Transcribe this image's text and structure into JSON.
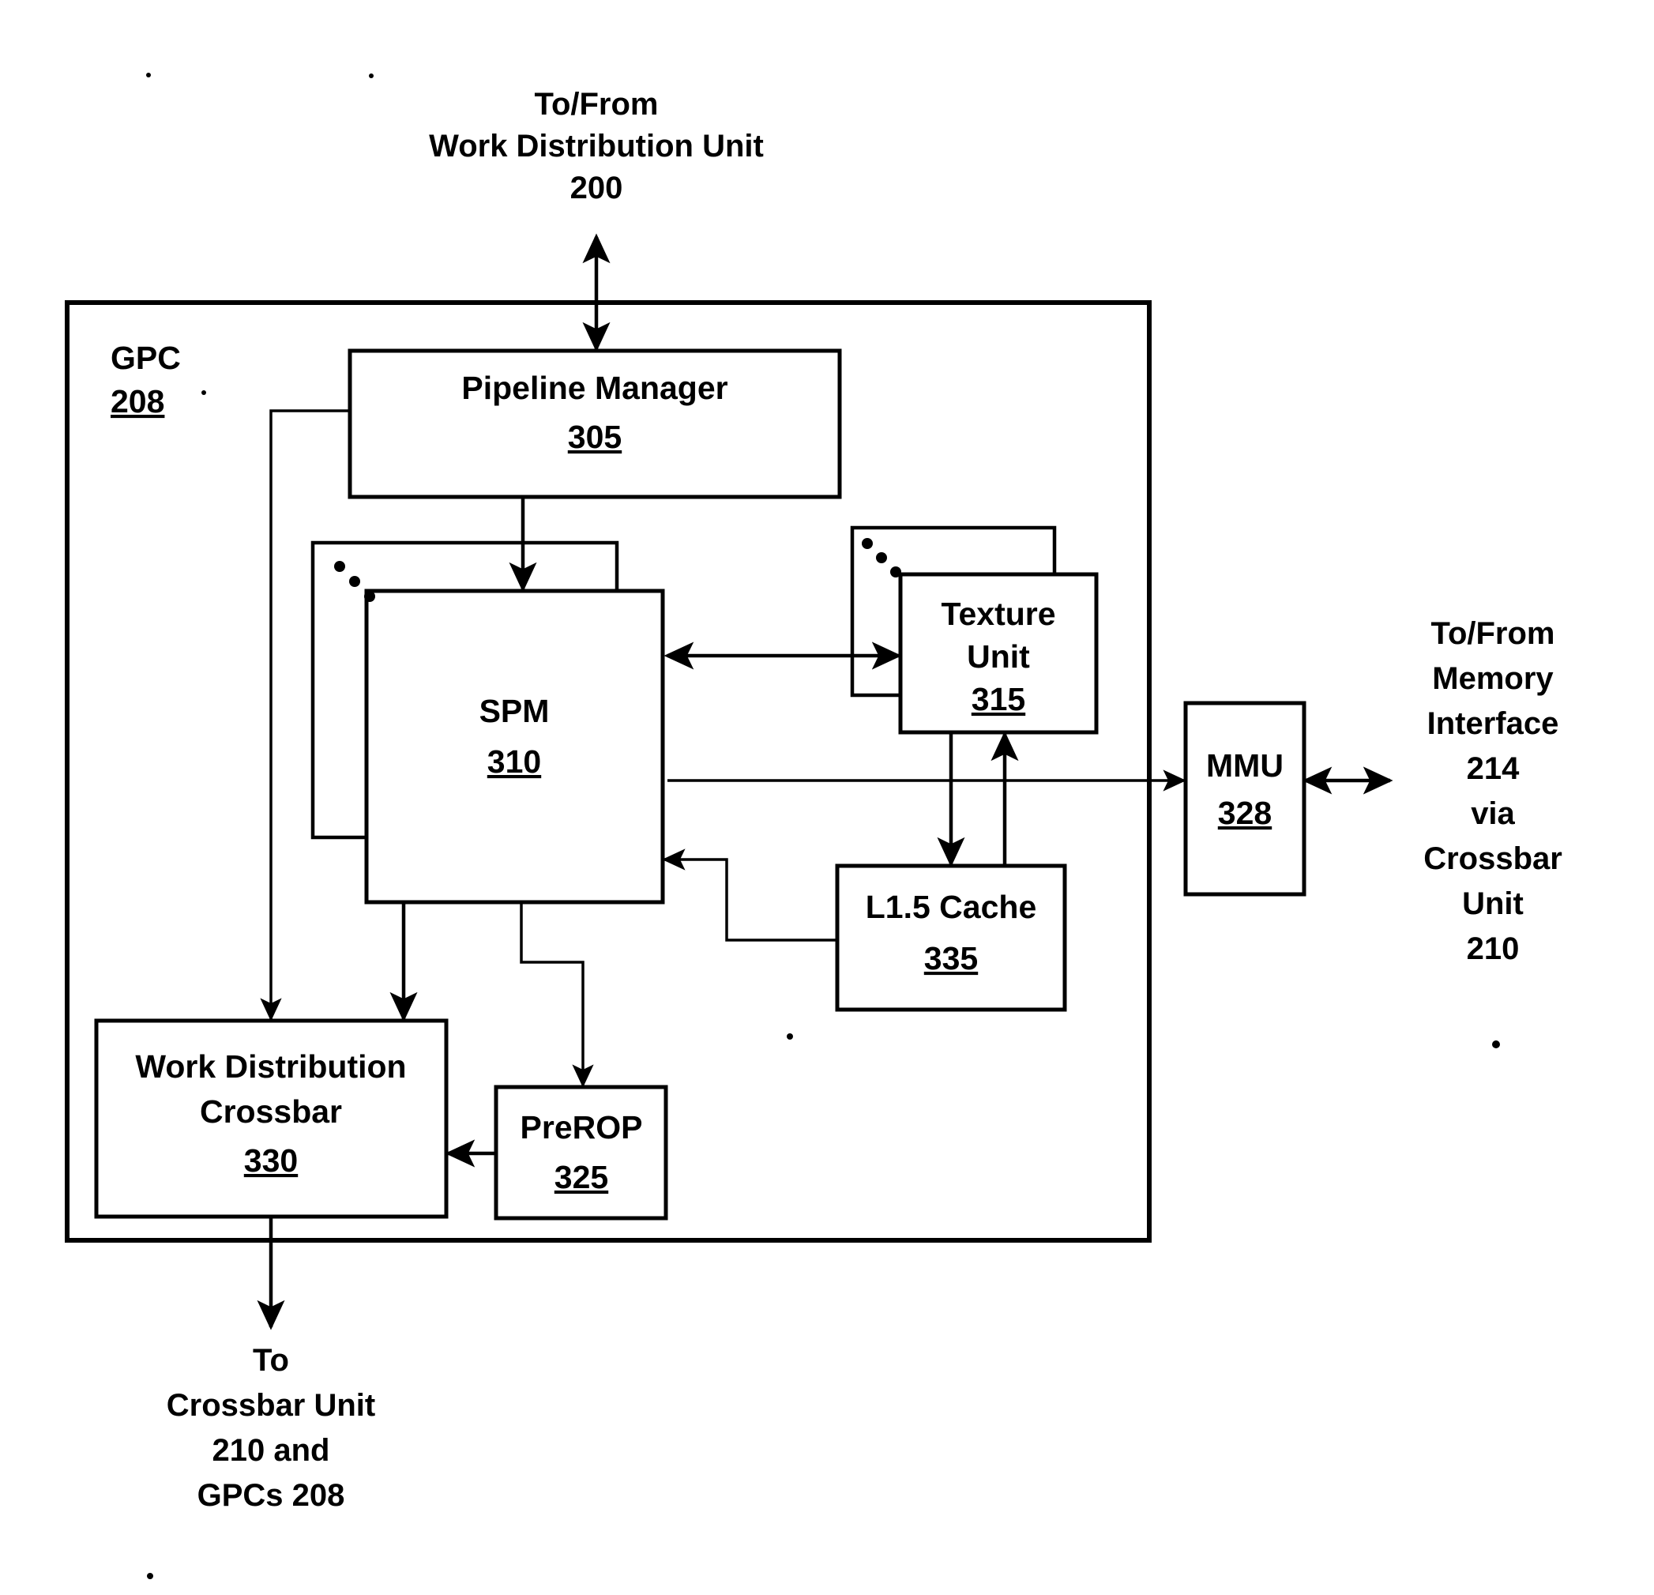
{
  "figure": {
    "title": "GPC 208 block diagram",
    "outer_block": {
      "name": "GPC",
      "ref": "208"
    },
    "external_labels": {
      "top": {
        "lines": [
          "To/From",
          "Work Distribution Unit",
          "200"
        ]
      },
      "right": {
        "lines": [
          "To/From",
          "Memory",
          "Interface",
          "214",
          "via",
          "Crossbar",
          "Unit",
          "210"
        ]
      },
      "bottom": {
        "lines": [
          "To",
          "Crossbar Unit",
          "210 and",
          "GPCs 208"
        ]
      }
    },
    "blocks": [
      {
        "id": "pipeline-manager",
        "name": "Pipeline Manager",
        "ref": "305",
        "stacked": false
      },
      {
        "id": "spm",
        "name": "SPM",
        "ref": "310",
        "stacked": true
      },
      {
        "id": "texture-unit",
        "name": "Texture Unit",
        "name_line1": "Texture",
        "name_line2": "Unit",
        "ref": "315",
        "stacked": true
      },
      {
        "id": "mmu",
        "name": "MMU",
        "ref": "328",
        "stacked": false
      },
      {
        "id": "l15-cache",
        "name": "L1.5 Cache",
        "ref": "335",
        "stacked": false
      },
      {
        "id": "work-distribution-crossbar",
        "name": "Work Distribution Crossbar",
        "name_line1": "Work Distribution",
        "name_line2": "Crossbar",
        "ref": "330",
        "stacked": false
      },
      {
        "id": "prerop",
        "name": "PreROP",
        "ref": "325",
        "stacked": false
      }
    ],
    "colors": {
      "ink": "#000000",
      "paper": "#ffffff"
    }
  }
}
